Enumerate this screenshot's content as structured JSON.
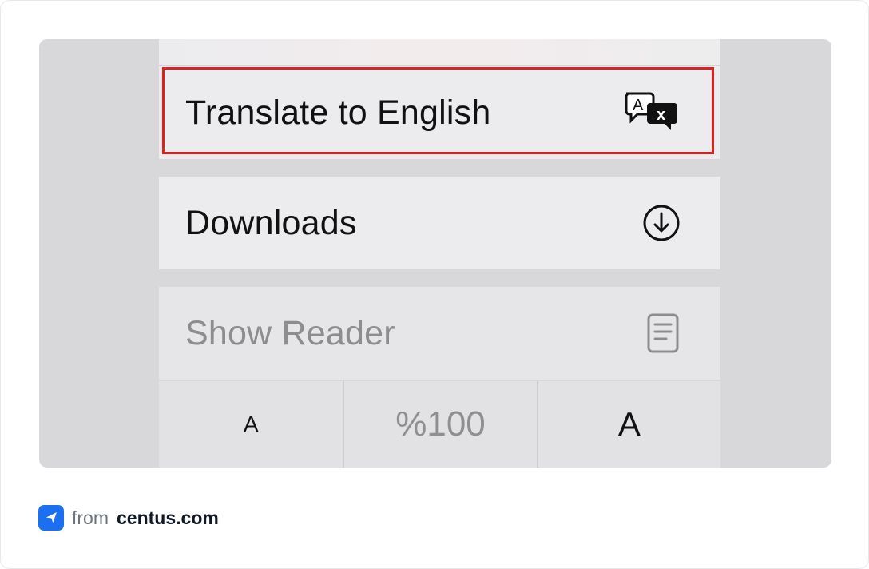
{
  "menu": {
    "translate_label": "Translate to English",
    "translate_icon": "translate-icon",
    "downloads_label": "Downloads",
    "downloads_icon": "download-circle-icon",
    "reader_label": "Show Reader",
    "reader_icon": "reader-icon"
  },
  "font_controls": {
    "decrease_label": "A",
    "zoom_level": "%100",
    "increase_label": "A"
  },
  "footer": {
    "from_text": "from",
    "brand_text": "centus.com",
    "logo_icon": "centus-logo-icon"
  },
  "colors": {
    "highlight": "#e0201c",
    "brand_blue": "#1d6ff2"
  }
}
